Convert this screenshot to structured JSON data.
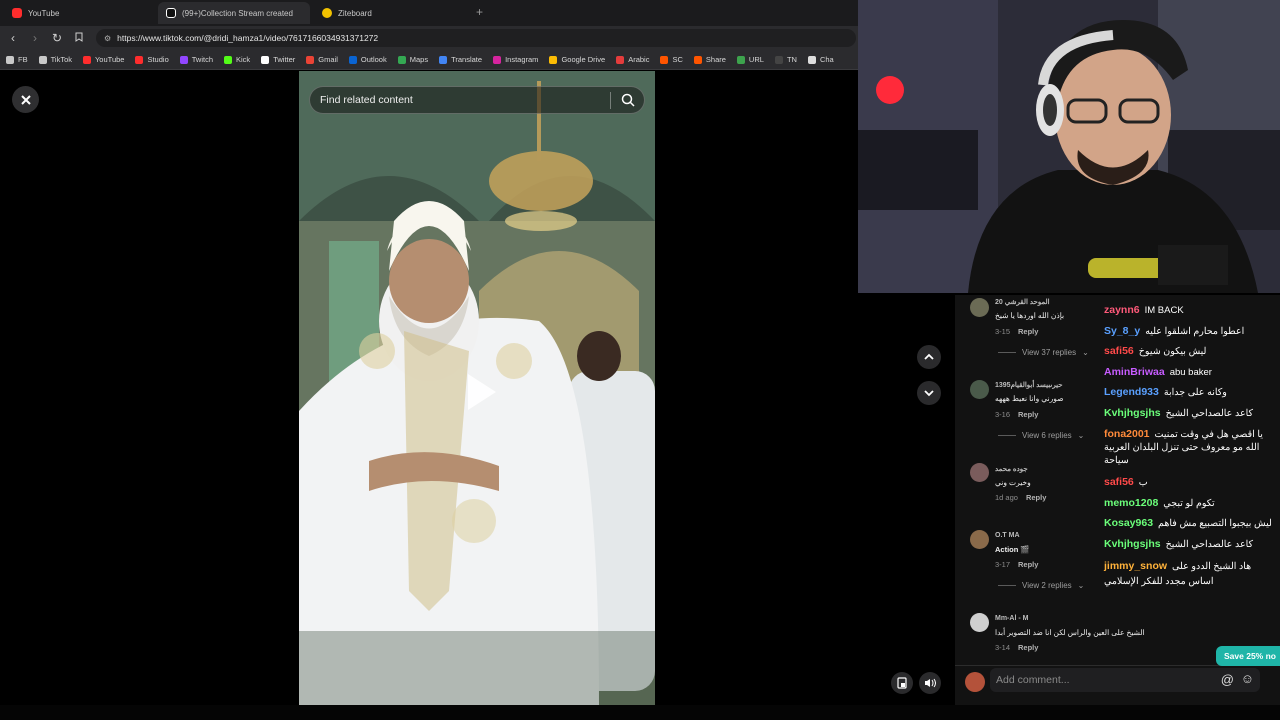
{
  "browser": {
    "tabs": [
      {
        "label": "YouTube",
        "active": false,
        "icon": "youtube-icon",
        "color": "#ff2d2d"
      },
      {
        "label": "(99+)Collection Stream created",
        "active": true,
        "icon": "tiktok-icon",
        "color": "#ffffff"
      },
      {
        "label": "Ziteboard",
        "active": false,
        "icon": "ziteboard-icon",
        "color": "#f2c200"
      }
    ],
    "url": "https://www.tiktok.com/@dridi_hamza1/video/7617166034931371272",
    "bookmarks": [
      {
        "label": "FB",
        "icon": "folder-icon",
        "color": "#c8c8c8"
      },
      {
        "label": "TikTok",
        "icon": "folder-icon",
        "color": "#c8c8c8"
      },
      {
        "label": "YouTube",
        "icon": "youtube-icon",
        "color": "#ff2d2d"
      },
      {
        "label": "Studio",
        "icon": "youtube-studio-icon",
        "color": "#ff2d2d"
      },
      {
        "label": "Twitch",
        "icon": "twitch-icon",
        "color": "#9146ff"
      },
      {
        "label": "Kick",
        "icon": "kick-icon",
        "color": "#53fc18"
      },
      {
        "label": "Twitter",
        "icon": "x-icon",
        "color": "#ffffff"
      },
      {
        "label": "Gmail",
        "icon": "gmail-icon",
        "color": "#ea4335"
      },
      {
        "label": "Outlook",
        "icon": "outlook-icon",
        "color": "#0a64d2"
      },
      {
        "label": "Maps",
        "icon": "maps-icon",
        "color": "#34a853"
      },
      {
        "label": "Translate",
        "icon": "translate-icon",
        "color": "#4285f4"
      },
      {
        "label": "Instagram",
        "icon": "instagram-icon",
        "color": "#d6249f"
      },
      {
        "label": "Google Drive",
        "icon": "drive-icon",
        "color": "#fbbc04"
      },
      {
        "label": "Arabic",
        "icon": "arabic-icon",
        "color": "#e43c3c"
      },
      {
        "label": "SC",
        "icon": "sc-icon",
        "color": "#ff5500"
      },
      {
        "label": "Share",
        "icon": "share-icon",
        "color": "#ff5500"
      },
      {
        "label": "URL",
        "icon": "url-icon",
        "color": "#3da34d"
      },
      {
        "label": "TN",
        "icon": "tn-icon",
        "color": "#444444"
      },
      {
        "label": "Cha",
        "icon": "chatgpt-icon",
        "color": "#dddddd"
      }
    ]
  },
  "video": {
    "search_placeholder": "Find related content"
  },
  "comments": [
    {
      "name": "الموحد القرشي 20",
      "text": "بإذن الله اوردها يا شيخ",
      "time": "3-15",
      "reply": "Reply",
      "replies": "View 37 replies",
      "avatar_color": "#6b6b55"
    },
    {
      "name": "1395حيرىبيسد أبوالقيام",
      "text": "صورني وانا نعيط هههه",
      "time": "3-16",
      "reply": "Reply",
      "replies": "View 6 replies",
      "avatar_color": "#4a5a4a"
    },
    {
      "name": "جوده محمد",
      "text": "وخيرت وني",
      "time": "1d ago",
      "reply": "Reply",
      "replies": "",
      "avatar_color": "#7a5c5c"
    },
    {
      "name": "O.T MA",
      "text": "Action 🎬",
      "time": "3-17",
      "reply": "Reply",
      "replies": "View 2 replies",
      "avatar_color": "#8a6a4a"
    },
    {
      "name": "Mm-Al - M",
      "text": "الشيخ على العين والراس لكن انا ضد التصوير أبدا",
      "time": "3-14",
      "reply": "Reply",
      "replies": "",
      "avatar_color": "#cfcfcf"
    }
  ],
  "chat": [
    {
      "user": "zaynn6",
      "msg": "IM BACK",
      "color": "#ff5a7a"
    },
    {
      "user": "Sy_8_y",
      "msg": "اعطوا محارم اشلقوا عليه",
      "color": "#5aa0ff"
    },
    {
      "user": "safi56",
      "msg": "ليش بيكون شيوخ",
      "color": "#ff4a4a"
    },
    {
      "user": "AminBriwaa",
      "msg": "abu baker",
      "color": "#c75cff"
    },
    {
      "user": "Legend933",
      "msg": "وكانه على جدابة",
      "color": "#5aa0ff"
    },
    {
      "user": "Kvhjhgsjhs",
      "msg": "كاعد عالصداحي الشيخ",
      "color": "#6bff7a"
    },
    {
      "user": "fona2001",
      "msg": "يا اقصي هل في وقت تمنيت الله مو معروف حتى تنزل البلدان العربية سياحة",
      "color": "#ff8a3a"
    },
    {
      "user": "safi56",
      "msg": "ب",
      "color": "#ff4a4a"
    },
    {
      "user": "memo1208",
      "msg": "تكوم لو تبجي",
      "color": "#6bff7a"
    },
    {
      "user": "Kosay963",
      "msg": "ليش بيجبوا التصبيع مش فاهم",
      "color": "#6bff7a"
    },
    {
      "user": "Kvhjhgsjhs",
      "msg": "كاعد عالصداحي الشيخ",
      "color": "#6bff7a"
    },
    {
      "user": "jimmy_snow",
      "msg": "هاد الشيخ الددو على اساس مجدد للفكر الإسلامي",
      "color": "#ffb23a"
    }
  ],
  "bottom": {
    "add_comment_placeholder": "Add comment...",
    "save_badge": "Save 25% no"
  },
  "colors": {
    "accent": "#1fb5a8",
    "bg": "#000000",
    "panel": "#121212"
  }
}
